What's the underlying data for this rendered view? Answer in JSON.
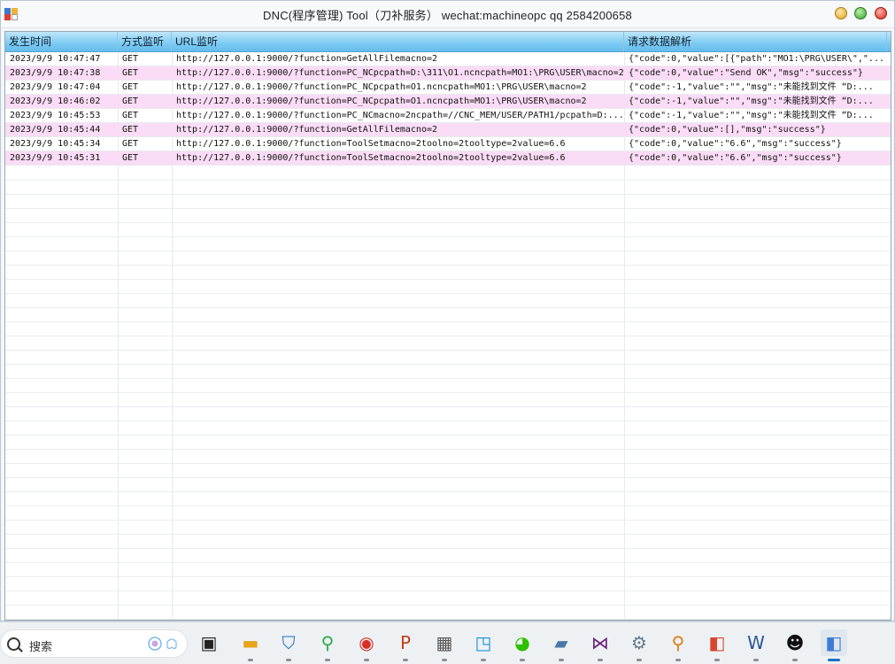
{
  "window": {
    "title": "DNC(程序管理)   Tool（刀补服务）  wechat:machineopc    qq 2584200658"
  },
  "grid": {
    "columns": [
      "发生时间",
      "方式监听",
      "URL监听",
      "请求数据解析"
    ],
    "rows": [
      {
        "time": "2023/9/9 10:47:47",
        "method": "GET",
        "url": "http://127.0.0.1:9000/?function=GetAllFilemacno=2",
        "data": "{\"code\":0,\"value\":[{\"path\":\"MO1:\\PRG\\USER\\\",\"..."
      },
      {
        "time": "2023/9/9 10:47:38",
        "method": "GET",
        "url": "http://127.0.0.1:9000/?function=PC_NCpcpath=D:\\311\\O1.ncncpath=MO1:\\PRG\\USER\\macno=2",
        "data": "{\"code\":0,\"value\":\"Send OK\",\"msg\":\"success\"}"
      },
      {
        "time": "2023/9/9 10:47:04",
        "method": "GET",
        "url": "http://127.0.0.1:9000/?function=PC_NCpcpath=O1.ncncpath=MO1:\\PRG\\USER\\macno=2",
        "data": "{\"code\":-1,\"value\":\"\",\"msg\":\"未能找到文件 “D:..."
      },
      {
        "time": "2023/9/9 10:46:02",
        "method": "GET",
        "url": "http://127.0.0.1:9000/?function=PC_NCpcpath=O1.ncncpath=MO1:\\PRG\\USER\\macno=2",
        "data": "{\"code\":-1,\"value\":\"\",\"msg\":\"未能找到文件 “D:..."
      },
      {
        "time": "2023/9/9 10:45:53",
        "method": "GET",
        "url": "http://127.0.0.1:9000/?function=PC_NCmacno=2ncpath=//CNC_MEM/USER/PATH1/pcpath=D:...",
        "data": "{\"code\":-1,\"value\":\"\",\"msg\":\"未能找到文件 “D:..."
      },
      {
        "time": "2023/9/9 10:45:44",
        "method": "GET",
        "url": "http://127.0.0.1:9000/?function=GetAllFilemacno=2",
        "data": "{\"code\":0,\"value\":[],\"msg\":\"success\"}"
      },
      {
        "time": "2023/9/9 10:45:34",
        "method": "GET",
        "url": "http://127.0.0.1:9000/?function=ToolSetmacno=2toolno=2tooltype=2value=6.6",
        "data": "{\"code\":0,\"value\":\"6.6\",\"msg\":\"success\"}"
      },
      {
        "time": "2023/9/9 10:45:31",
        "method": "GET",
        "url": "http://127.0.0.1:9000/?function=ToolSetmacno=2toolno=2tooltype=2value=6.6",
        "data": "{\"code\":0,\"value\":\"6.6\",\"msg\":\"success\"}"
      }
    ]
  },
  "taskbar": {
    "search_label": "搜索",
    "icons": [
      {
        "name": "task-view-icon",
        "glyph": "▣",
        "color": "#222222"
      },
      {
        "name": "file-explorer-icon",
        "glyph": "▬",
        "color": "#e8a317"
      },
      {
        "name": "security-shield-icon",
        "glyph": "⛉",
        "color": "#1a6fc4"
      },
      {
        "name": "search-tool-icon",
        "glyph": "⚲",
        "color": "#2aa84a"
      },
      {
        "name": "chrome-icon",
        "glyph": "◉",
        "color": "#d93025"
      },
      {
        "name": "powerpoint-icon",
        "glyph": "P",
        "color": "#c43e1c"
      },
      {
        "name": "calculator-icon",
        "glyph": "▦",
        "color": "#555555"
      },
      {
        "name": "snipping-icon",
        "glyph": "◳",
        "color": "#1a8fd6"
      },
      {
        "name": "wechat-icon",
        "glyph": "◕",
        "color": "#2dc100"
      },
      {
        "name": "resource-monitor-icon",
        "glyph": "▰",
        "color": "#4b79a6"
      },
      {
        "name": "visual-studio-icon",
        "glyph": "⋈",
        "color": "#68217a"
      },
      {
        "name": "settings-gear-icon",
        "glyph": "⚙",
        "color": "#6a7a8a"
      },
      {
        "name": "magnifier-icon",
        "glyph": "⚲",
        "color": "#e07a10"
      },
      {
        "name": "tool-app-icon",
        "glyph": "◧",
        "color": "#d6452c"
      },
      {
        "name": "word-icon",
        "glyph": "W",
        "color": "#2b579a"
      },
      {
        "name": "qq-icon",
        "glyph": "☻",
        "color": "#111111"
      },
      {
        "name": "dnc-app-icon",
        "glyph": "◧",
        "color": "#3a7bd5"
      }
    ]
  }
}
